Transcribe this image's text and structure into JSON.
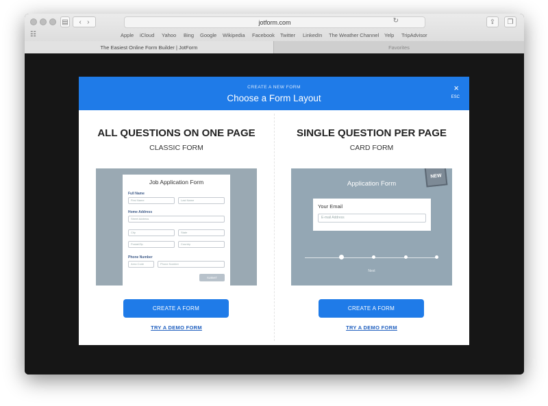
{
  "browser": {
    "url": "jotform.com",
    "sidebar_icon": "sidebar-icon",
    "bookmarks": [
      "Apple",
      "iCloud",
      "Yahoo",
      "Bing",
      "Google",
      "Wikipedia",
      "Facebook",
      "Twitter",
      "LinkedIn",
      "The Weather Channel",
      "Yelp",
      "TripAdvisor"
    ],
    "tabs": [
      {
        "label": "The Easiest Online Form Builder | JotForm"
      },
      {
        "label": "Favorites"
      }
    ]
  },
  "modal": {
    "subtitle": "CREATE A NEW FORM",
    "title": "Choose a Form Layout",
    "close_glyph": "×",
    "esc_label": "ESC",
    "accent_color": "#1f7be8"
  },
  "classic": {
    "title": "ALL QUESTIONS ON ONE PAGE",
    "subtitle": "CLASSIC FORM",
    "button": "CREATE A FORM",
    "demo_link": "TRY A DEMO FORM",
    "preview": {
      "form_title": "Job Application Form",
      "full_name_label": "Full Name",
      "first_name": "First Name",
      "last_name": "Last Name",
      "home_address_label": "Home Address",
      "street": "Street Address",
      "city": "City",
      "state": "State",
      "postal": "Postal/Zip",
      "country": "Country",
      "phone_label": "Phone Number",
      "area_code": "Area Code",
      "phone": "Phone Number",
      "submit": "SUBMIT"
    }
  },
  "card": {
    "title": "SINGLE QUESTION PER PAGE",
    "subtitle": "CARD FORM",
    "button": "CREATE A FORM",
    "demo_link": "TRY A DEMO FORM",
    "preview": {
      "badge": "NEW",
      "form_title": "Application Form",
      "question": "Your Email",
      "placeholder": "E-mail Address",
      "next": "Next"
    }
  }
}
